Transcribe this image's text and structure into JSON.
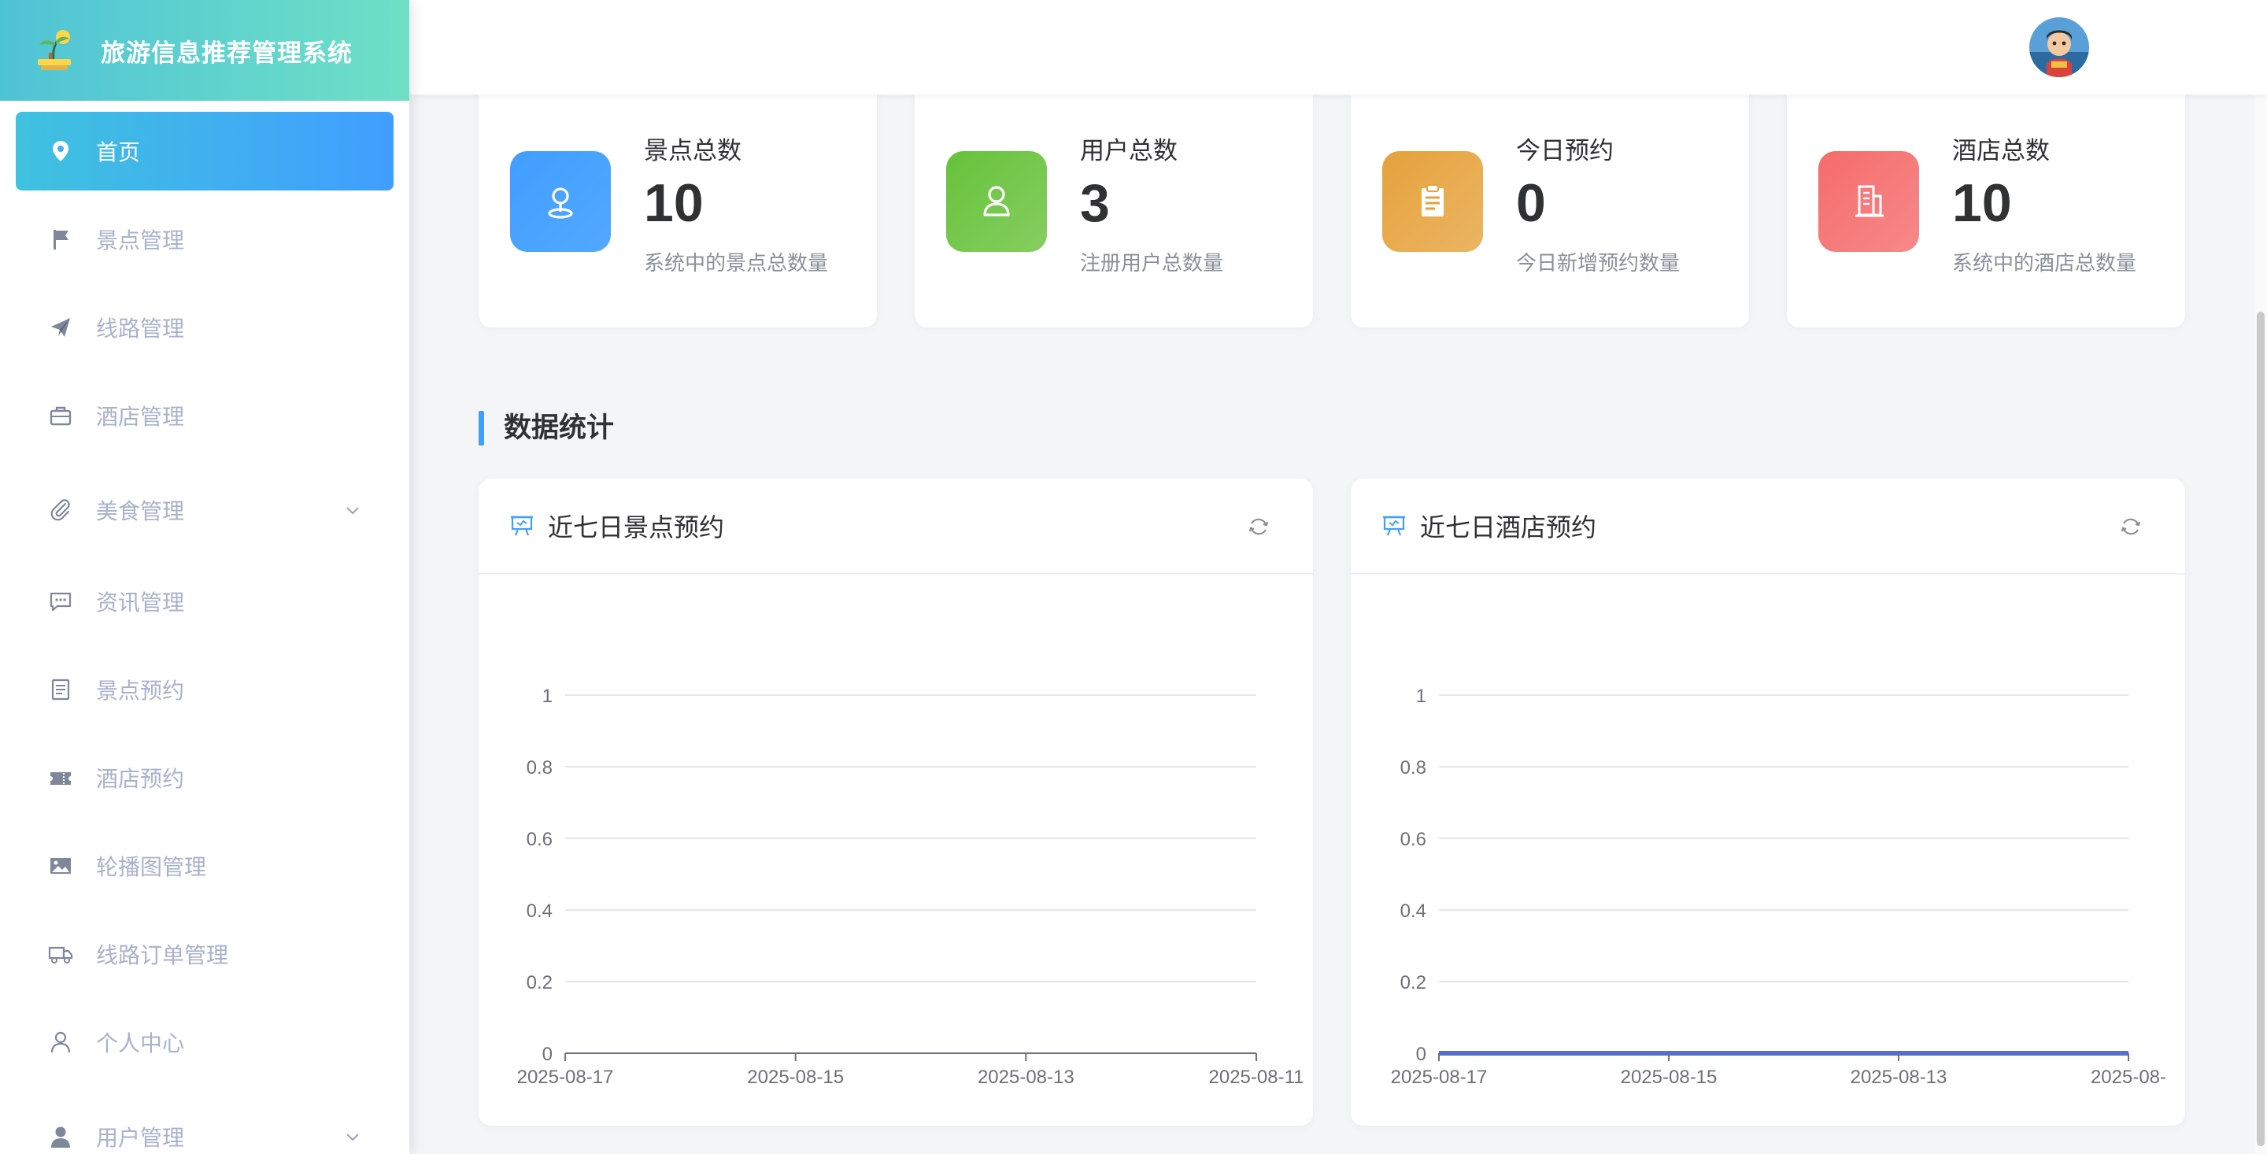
{
  "brand": {
    "title": "旅游信息推荐管理系统"
  },
  "sidebar": {
    "items": [
      {
        "label": "首页",
        "icon": "location-pin-icon",
        "active": true
      },
      {
        "label": "景点管理",
        "icon": "flag-icon"
      },
      {
        "label": "线路管理",
        "icon": "paper-plane-icon"
      },
      {
        "label": "酒店管理",
        "icon": "briefcase-icon"
      },
      {
        "label": "美食管理",
        "icon": "paperclip-icon",
        "expandable": true
      },
      {
        "label": "资讯管理",
        "icon": "chat-icon"
      },
      {
        "label": "景点预约",
        "icon": "document-icon"
      },
      {
        "label": "酒店预约",
        "icon": "ticket-icon"
      },
      {
        "label": "轮播图管理",
        "icon": "picture-icon"
      },
      {
        "label": "线路订单管理",
        "icon": "truck-icon"
      },
      {
        "label": "个人中心",
        "icon": "user-icon"
      },
      {
        "label": "用户管理",
        "icon": "user-filled-icon",
        "expandable": true
      }
    ]
  },
  "stats": [
    {
      "label": "景点总数",
      "value": "10",
      "desc": "系统中的景点总数量",
      "icon": "map-pin-icon",
      "color": "#409eff"
    },
    {
      "label": "用户总数",
      "value": "3",
      "desc": "注册用户总数量",
      "icon": "user-icon",
      "color": "#67c23a"
    },
    {
      "label": "今日预约",
      "value": "0",
      "desc": "今日新增预约数量",
      "icon": "clipboard-icon",
      "color": "#e6a23c"
    },
    {
      "label": "酒店总数",
      "value": "10",
      "desc": "系统中的酒店总数量",
      "icon": "building-icon",
      "color": "#f56c6c"
    }
  ],
  "section": {
    "title": "数据统计"
  },
  "charts": {
    "left": {
      "title": "近七日景点预约"
    },
    "right": {
      "title": "近七日酒店预约"
    }
  },
  "chart_data": [
    {
      "type": "line",
      "title": "近七日景点预约",
      "categories": [
        "2025-08-17",
        "2025-08-15",
        "2025-08-13",
        "2025-08-11"
      ],
      "series": [
        {
          "values": [
            0,
            0,
            0,
            0
          ]
        }
      ],
      "ylim": [
        0,
        1
      ],
      "yticks": [
        "0",
        "0.2",
        "0.4",
        "0.6",
        "0.8",
        "1"
      ],
      "grid": true
    },
    {
      "type": "line",
      "title": "近七日酒店预约",
      "categories": [
        "2025-08-17",
        "2025-08-15",
        "2025-08-13",
        "2025-08-"
      ],
      "series": [
        {
          "values": [
            0,
            0,
            0,
            0
          ],
          "color": "#5470c6"
        }
      ],
      "ylim": [
        0,
        1
      ],
      "yticks": [
        "0",
        "0.2",
        "0.4",
        "0.6",
        "0.8",
        "1"
      ],
      "grid": true
    }
  ]
}
